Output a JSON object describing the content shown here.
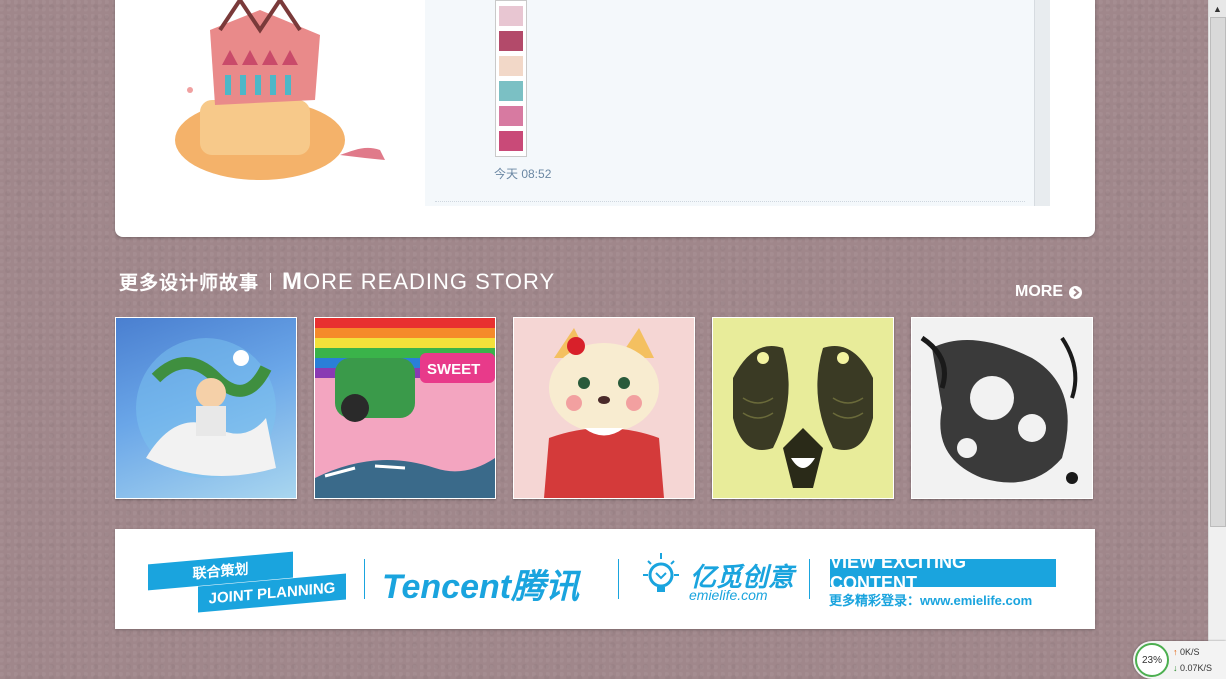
{
  "message": {
    "time": "今天 08:52"
  },
  "section": {
    "title_cn": "更多设计师故事",
    "title_en_cap": "M",
    "title_en_rest": "ORE READING STORY",
    "more_label": "MORE"
  },
  "gallery": {
    "items": [
      "illustration-boy-unicorn",
      "illustration-sweet-car",
      "illustration-cat-sweater",
      "illustration-mirrored-birds",
      "illustration-ink-face"
    ]
  },
  "banner": {
    "joint_cn": "联合策划",
    "joint_en": "JOINT PLANNING",
    "tencent": "Tencent腾讯",
    "emie_cn": "亿觅创意",
    "emie_en": "emielife.com",
    "view_label": "VIEW EXCITING CONTENT",
    "view_sub": "更多精彩登录：www.emielife.com"
  },
  "net_widget": {
    "percent": "23%",
    "up": "0K/S",
    "down": "0.07K/S"
  },
  "colors": {
    "accent": "#1aa4de",
    "background": "#a0878b"
  }
}
